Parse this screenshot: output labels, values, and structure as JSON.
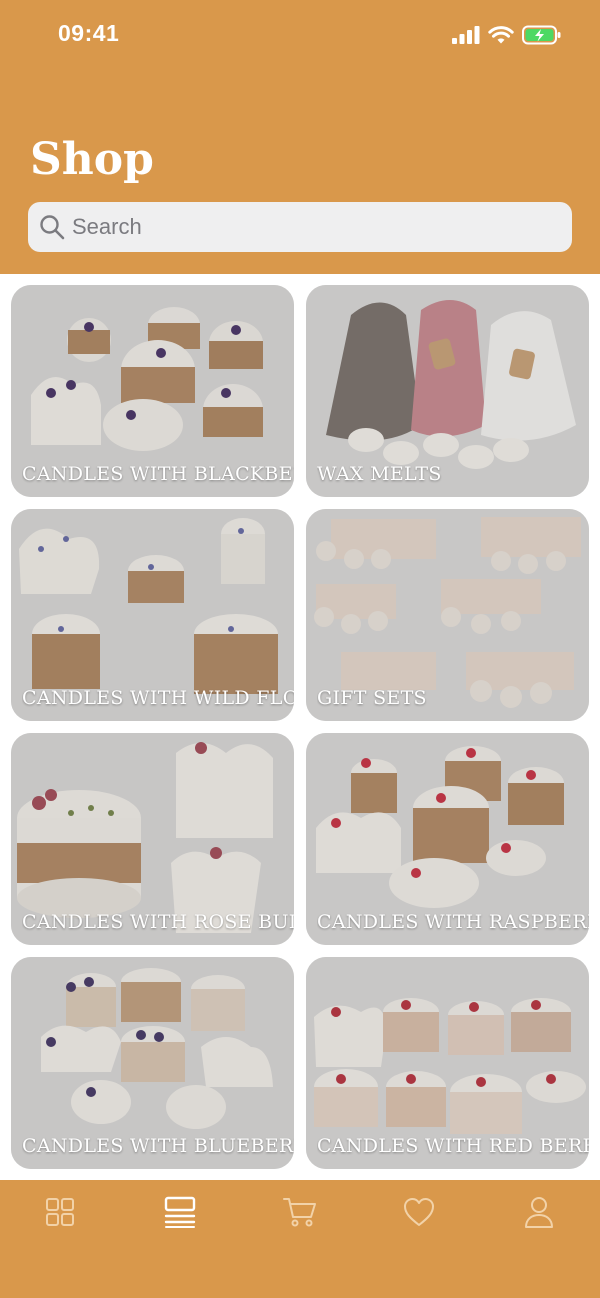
{
  "status_bar": {
    "time": "09:41"
  },
  "header": {
    "title": "Shop"
  },
  "search": {
    "placeholder": "Search"
  },
  "categories": [
    {
      "label": "CANDLES WITH BLACKBERRY",
      "image": "candles-blackberry"
    },
    {
      "label": "WAX MELTS",
      "image": "wax-melts"
    },
    {
      "label": "CANDLES WITH WILD FLOWERS",
      "image": "candles-wild-flowers"
    },
    {
      "label": "GIFT SETS",
      "image": "gift-sets"
    },
    {
      "label": "CANDLES WITH ROSE BUDS",
      "image": "candles-rose-buds"
    },
    {
      "label": "CANDLES WITH RASPBERRY",
      "image": "candles-raspberry"
    },
    {
      "label": "CANDLES WITH BLUEBERRY",
      "image": "candles-blueberry"
    },
    {
      "label": "CANDLES WITH RED BERRIES",
      "image": "candles-red-berries"
    }
  ],
  "tabbar": {
    "items": [
      {
        "icon": "grid-icon",
        "active": false
      },
      {
        "icon": "list-icon",
        "active": true
      },
      {
        "icon": "cart-icon",
        "active": false
      },
      {
        "icon": "heart-icon",
        "active": false
      },
      {
        "icon": "profile-icon",
        "active": false
      }
    ]
  },
  "colors": {
    "brand": "#D9984B",
    "card_bg": "#D9D8D7",
    "search_bg": "#EFEFF0"
  }
}
